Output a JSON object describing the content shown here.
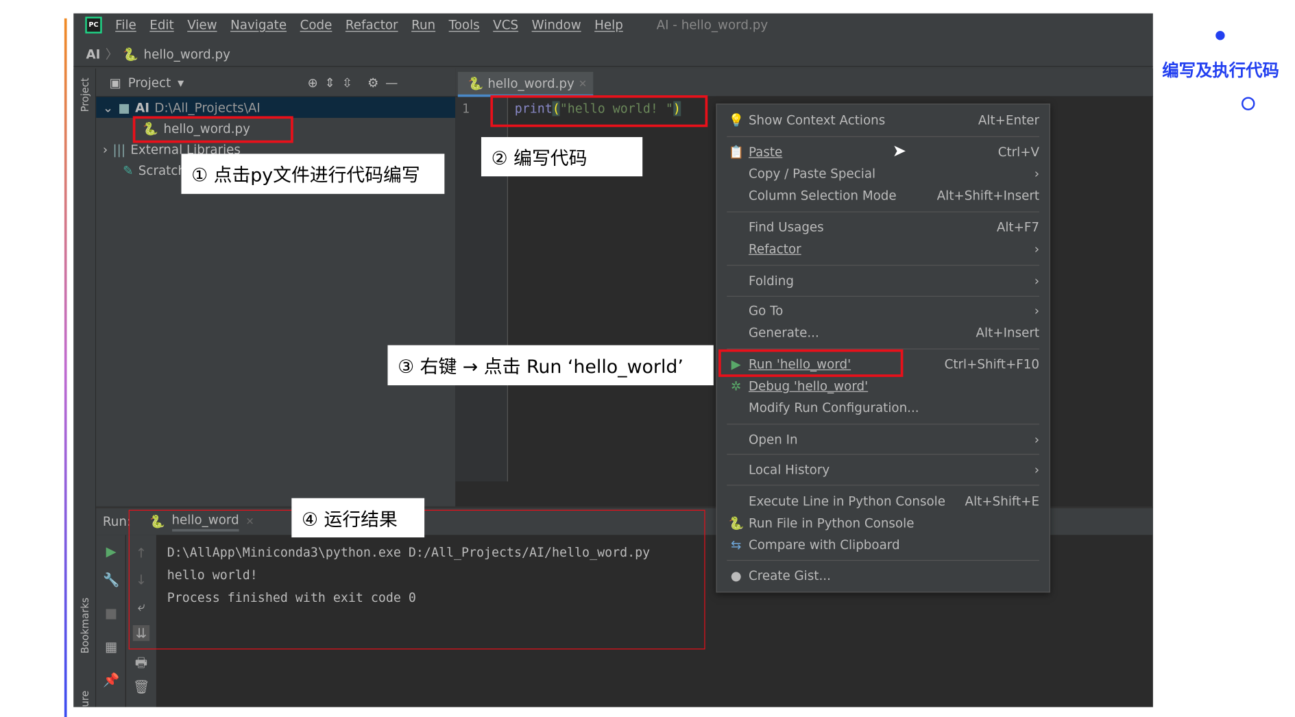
{
  "slide": {
    "title": "编写及执行代码",
    "accent_color": "#2340f0"
  },
  "menubar": {
    "items": [
      "File",
      "Edit",
      "View",
      "Navigate",
      "Code",
      "Refactor",
      "Run",
      "Tools",
      "VCS",
      "Window",
      "Help"
    ],
    "window_title": "AI - hello_word.py",
    "logo": "PC"
  },
  "navbar": {
    "project": "AI",
    "file": "hello_word.py"
  },
  "toolstrip": {
    "project": "Project",
    "bookmarks": "Bookmarks",
    "structure": "ure"
  },
  "project_panel": {
    "title": "Project",
    "root_name": "AI",
    "root_path": "D:\\All_Projects\\AI",
    "file": "hello_word.py",
    "external": "External Libraries",
    "scratches": "Scratches and Consoles"
  },
  "editor": {
    "tab": "hello_word.py",
    "line_number": "1",
    "code_fn": "print",
    "code_open": "(",
    "code_str": "\"hello world! \"",
    "code_close": ")"
  },
  "run": {
    "label": "Run:",
    "tab": "hello_word",
    "lines": [
      "D:\\AllApp\\Miniconda3\\python.exe D:/All_Projects/AI/hello_word.py",
      "hello world!",
      "",
      "Process finished with exit code 0"
    ]
  },
  "context_menu": {
    "items": [
      {
        "label": "Show Context Actions",
        "shortcut": "Alt+Enter",
        "icon": "bulb-icon"
      },
      {
        "label": "Paste",
        "shortcut": "Ctrl+V",
        "icon": "clipboard-icon"
      },
      {
        "label": "Copy / Paste Special",
        "shortcut": "›"
      },
      {
        "label": "Column Selection Mode",
        "shortcut": "Alt+Shift+Insert"
      },
      {
        "label": "Find Usages",
        "shortcut": "Alt+F7"
      },
      {
        "label": "Refactor",
        "shortcut": "›"
      },
      {
        "label": "Folding",
        "shortcut": "›"
      },
      {
        "label": "Go To",
        "shortcut": "›"
      },
      {
        "label": "Generate...",
        "shortcut": "Alt+Insert"
      },
      {
        "label": "Run 'hello_word'",
        "shortcut": "Ctrl+Shift+F10",
        "icon": "run-icon"
      },
      {
        "label": "Debug 'hello_word'",
        "shortcut": "",
        "icon": "debug-icon"
      },
      {
        "label": "Modify Run Configuration...",
        "shortcut": ""
      },
      {
        "label": "Open In",
        "shortcut": "›"
      },
      {
        "label": "Local History",
        "shortcut": "›"
      },
      {
        "label": "Execute Line in Python Console",
        "shortcut": "Alt+Shift+E"
      },
      {
        "label": "Run File in Python Console",
        "shortcut": "",
        "icon": "python-icon"
      },
      {
        "label": "Compare with Clipboard",
        "shortcut": "",
        "icon": "compare-icon"
      },
      {
        "label": "Create Gist...",
        "shortcut": "",
        "icon": "github-icon"
      }
    ]
  },
  "callouts": {
    "step1": "① 点击py文件进行代码编写",
    "step2": "② 编写代码",
    "step3": "③ 右键 → 点击 Run ‘hello_world’",
    "step4": "④ 运行结果"
  }
}
